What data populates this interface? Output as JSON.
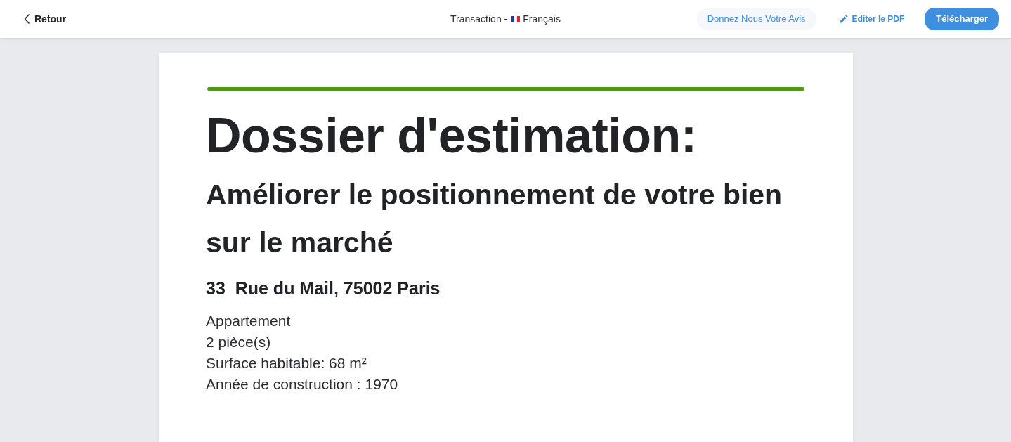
{
  "header": {
    "back": {
      "label": "Retour"
    },
    "title_prefix": "Transaction -",
    "language": "Français",
    "actions": [
      {
        "kind": "soft",
        "label": "Donnez Nous Votre Avis"
      },
      {
        "kind": "link",
        "label": "Editer le PDF"
      },
      {
        "kind": "primary",
        "label": "Télécharger"
      }
    ]
  },
  "document": {
    "title": "Dossier d'estimation:",
    "subtitle": "Améliorer le positionnement de votre bien sur le marché",
    "address": "33  Rue du Mail, 75002 Paris",
    "details": [
      "Appartement",
      "2 pièce(s)",
      "Surface habitable: 68 m²",
      "Année de construction : 1970"
    ]
  }
}
